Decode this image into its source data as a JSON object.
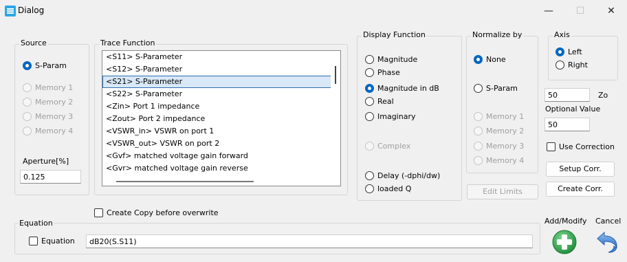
{
  "window": {
    "title": "Dialog",
    "minimize": "—",
    "maximize": "☐",
    "close": "✕"
  },
  "source": {
    "label": "Source",
    "options": [
      {
        "label": "S-Param",
        "checked": true,
        "enabled": true
      },
      {
        "label": "Memory 1",
        "checked": false,
        "enabled": false
      },
      {
        "label": "Memory 2",
        "checked": false,
        "enabled": false
      },
      {
        "label": "Memory 3",
        "checked": false,
        "enabled": false
      },
      {
        "label": "Memory 4",
        "checked": false,
        "enabled": false
      }
    ],
    "aperture_label": "Aperture[%]",
    "aperture_value": "0.125"
  },
  "trace_function": {
    "label": "Trace Function",
    "items": [
      "<S11> S-Parameter",
      "<S12> S-Parameter",
      "<S21> S-Parameter",
      "<S22> S-Parameter",
      "<Zin> Port 1 impedance",
      "<Zout> Port 2 impedance",
      "<VSWR_in> VSWR on port 1",
      "<VSWR_out> VSWR on port 2",
      "<Gvf> matched voltage gain forward",
      "<Gvr> matched voltage gain reverse"
    ],
    "selected": "<S21> S-Parameter"
  },
  "create_copy": {
    "label": "Create Copy before overwrite",
    "checked": false
  },
  "display_function": {
    "label": "Display Function",
    "options": [
      {
        "label": "Magnitude",
        "checked": false,
        "enabled": true
      },
      {
        "label": "Phase",
        "checked": false,
        "enabled": true
      },
      {
        "label": "Magnitude in dB",
        "checked": true,
        "enabled": true
      },
      {
        "label": "Real",
        "checked": false,
        "enabled": true
      },
      {
        "label": "Imaginary",
        "checked": false,
        "enabled": true
      },
      {
        "label": "Complex",
        "checked": false,
        "enabled": false
      },
      {
        "label": "Delay (-dphi/dw)",
        "checked": false,
        "enabled": true
      },
      {
        "label": "loaded Q",
        "checked": false,
        "enabled": true
      }
    ]
  },
  "normalize_by": {
    "label": "Normalize by",
    "options": [
      {
        "label": "None",
        "checked": true,
        "enabled": true
      },
      {
        "label": "S-Param",
        "checked": false,
        "enabled": true
      },
      {
        "label": "Memory 1",
        "checked": false,
        "enabled": false
      },
      {
        "label": "Memory 2",
        "checked": false,
        "enabled": false
      },
      {
        "label": "Memory 3",
        "checked": false,
        "enabled": false
      },
      {
        "label": "Memory 4",
        "checked": false,
        "enabled": false
      }
    ],
    "edit_limits": "Edit Limits"
  },
  "axis": {
    "label": "Axis",
    "options": [
      {
        "label": "Left",
        "checked": true
      },
      {
        "label": "Right",
        "checked": false
      }
    ]
  },
  "zo": {
    "label": "Zo",
    "value": "50"
  },
  "optional_value": {
    "label": "Optional Value",
    "value": "50"
  },
  "use_correction": {
    "label": "Use Correction",
    "checked": false
  },
  "setup_corr": "Setup Corr.",
  "create_corr": "Create Corr.",
  "equation": {
    "group_label": "Equation",
    "checkbox_label": "Equation",
    "checked": false,
    "value": "dB20(S.S11)"
  },
  "actions": {
    "add_modify": "Add/Modify",
    "cancel": "Cancel"
  },
  "colors": {
    "accent": "#0067c0",
    "add_icon": "#33a852",
    "cancel_icon": "#3a7fd5"
  }
}
